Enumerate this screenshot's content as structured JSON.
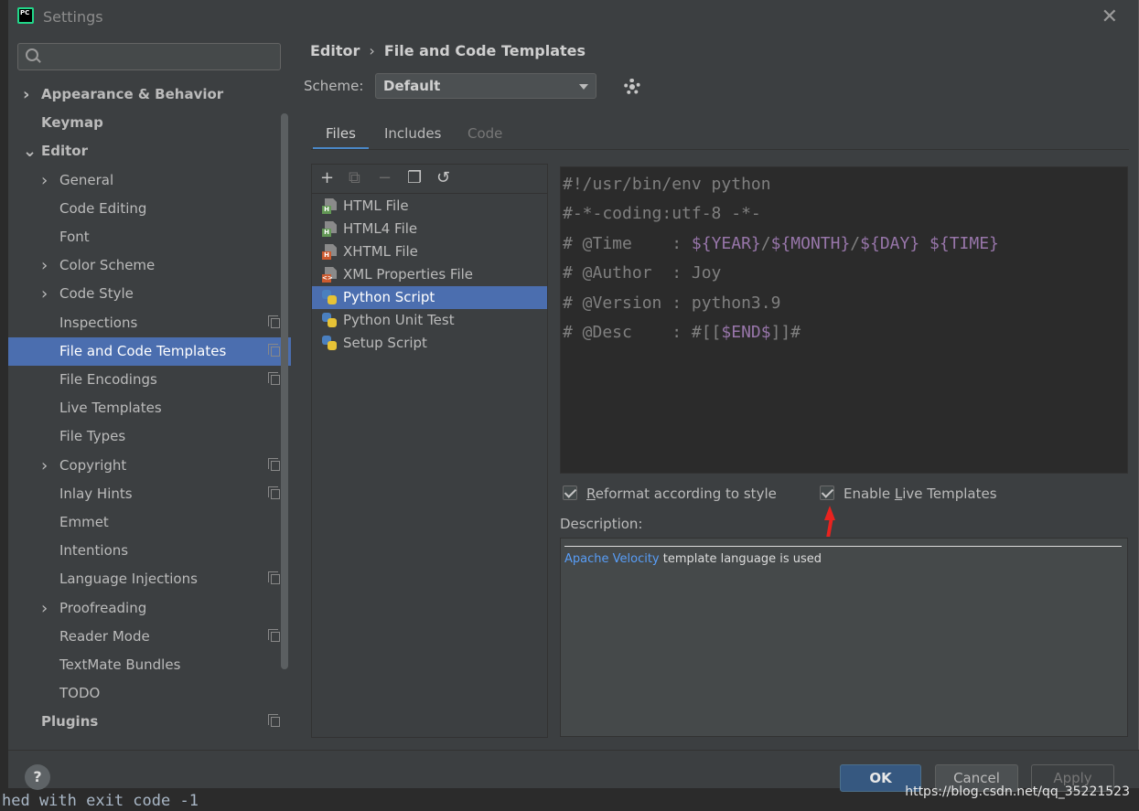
{
  "window": {
    "title": "Settings",
    "close_label": "✕"
  },
  "search": {
    "placeholder": "",
    "value": ""
  },
  "tree": [
    {
      "label": "Appearance & Behavior",
      "bold": true,
      "chevron": ">",
      "indent": 0
    },
    {
      "label": "Keymap",
      "bold": true,
      "chevron": "",
      "indent": 0
    },
    {
      "label": "Editor",
      "bold": true,
      "chevron": "v",
      "indent": 0
    },
    {
      "label": "General",
      "bold": false,
      "chevron": ">",
      "indent": 1
    },
    {
      "label": "Code Editing",
      "bold": false,
      "chevron": "",
      "indent": 1
    },
    {
      "label": "Font",
      "bold": false,
      "chevron": "",
      "indent": 1
    },
    {
      "label": "Color Scheme",
      "bold": false,
      "chevron": ">",
      "indent": 1
    },
    {
      "label": "Code Style",
      "bold": false,
      "chevron": ">",
      "indent": 1
    },
    {
      "label": "Inspections",
      "bold": false,
      "chevron": "",
      "indent": 1,
      "project_icon": true
    },
    {
      "label": "File and Code Templates",
      "bold": false,
      "chevron": "",
      "indent": 1,
      "selected": true,
      "project_icon": true
    },
    {
      "label": "File Encodings",
      "bold": false,
      "chevron": "",
      "indent": 1,
      "project_icon": true
    },
    {
      "label": "Live Templates",
      "bold": false,
      "chevron": "",
      "indent": 1
    },
    {
      "label": "File Types",
      "bold": false,
      "chevron": "",
      "indent": 1
    },
    {
      "label": "Copyright",
      "bold": false,
      "chevron": ">",
      "indent": 1,
      "project_icon": true
    },
    {
      "label": "Inlay Hints",
      "bold": false,
      "chevron": "",
      "indent": 1,
      "project_icon": true
    },
    {
      "label": "Emmet",
      "bold": false,
      "chevron": "",
      "indent": 1
    },
    {
      "label": "Intentions",
      "bold": false,
      "chevron": "",
      "indent": 1
    },
    {
      "label": "Language Injections",
      "bold": false,
      "chevron": "",
      "indent": 1,
      "project_icon": true
    },
    {
      "label": "Proofreading",
      "bold": false,
      "chevron": ">",
      "indent": 1
    },
    {
      "label": "Reader Mode",
      "bold": false,
      "chevron": "",
      "indent": 1,
      "project_icon": true
    },
    {
      "label": "TextMate Bundles",
      "bold": false,
      "chevron": "",
      "indent": 1
    },
    {
      "label": "TODO",
      "bold": false,
      "chevron": "",
      "indent": 1
    },
    {
      "label": "Plugins",
      "bold": true,
      "chevron": "",
      "indent": 0,
      "project_icon": true
    }
  ],
  "breadcrumb": {
    "parent": "Editor",
    "separator": "›",
    "current": "File and Code Templates"
  },
  "scheme": {
    "label": "Scheme:",
    "value": "Default"
  },
  "tabs": [
    {
      "label": "Files",
      "state": "active"
    },
    {
      "label": "Includes",
      "state": "normal"
    },
    {
      "label": "Code",
      "state": "disabled"
    }
  ],
  "toolbar": {
    "add": "+",
    "copy": "⧉",
    "remove": "−",
    "duplicate": "❐",
    "reset": "↺"
  },
  "files": [
    {
      "name": "HTML File",
      "icon": "html-file-icon",
      "tag": "H",
      "tag_color": "#629755"
    },
    {
      "name": "HTML4 File",
      "icon": "html4-file-icon",
      "tag": "H",
      "tag_color": "#629755"
    },
    {
      "name": "XHTML File",
      "icon": "xhtml-file-icon",
      "tag": "H",
      "tag_color": "#cc5a2f"
    },
    {
      "name": "XML Properties File",
      "icon": "xml-file-icon",
      "tag": "<>",
      "tag_color": "#cc5a2f"
    },
    {
      "name": "Python Script",
      "icon": "python-icon",
      "selected": true
    },
    {
      "name": "Python Unit Test",
      "icon": "python-icon"
    },
    {
      "name": "Setup Script",
      "icon": "python-icon"
    }
  ],
  "code": {
    "line1": "#!/usr/bin/env python",
    "line2": "#-*-coding:utf-8 -*-",
    "line3_prefix": "# @Time    : ",
    "line3_year": "${YEAR}",
    "line3_slash1": "/",
    "line3_month": "${MONTH}",
    "line3_slash2": "/",
    "line3_day": "${DAY}",
    "line3_space": " ",
    "line3_time": "${TIME}",
    "line4": "# @Author  : Joy",
    "line5": "# @Version : python3.9",
    "line6_prefix": "# @Desc    : #[[",
    "line6_var": "$END$",
    "line6_suffix": "]]#"
  },
  "options": {
    "reformat_pre": "",
    "reformat_u": "R",
    "reformat_post": "eformat according to style",
    "reformat_checked": true,
    "live_pre": "Enable ",
    "live_u": "L",
    "live_post": "ive Templates",
    "live_checked": true
  },
  "description": {
    "label": "Description:",
    "link": "Apache Velocity",
    "text": " template language is used"
  },
  "buttons": {
    "help": "?",
    "ok": "OK",
    "cancel": "Cancel",
    "apply": "Apply"
  },
  "background": {
    "console_text": "hed with exit code -1",
    "watermark": "https://blog.csdn.net/qq_35221523"
  },
  "colors": {
    "accent": "#4b6eaf",
    "tab_underline": "#4a88c7",
    "arrow": "#e8231f",
    "template_var": "#9876aa"
  }
}
